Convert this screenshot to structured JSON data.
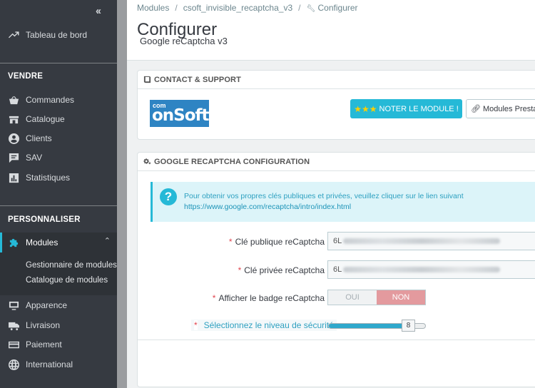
{
  "sidebar": {
    "collapse_icon": "double-chevron-left-icon",
    "dashboard": {
      "label": "Tableau de bord",
      "icon": "trending-up-icon"
    },
    "section_sell": "VENDRE",
    "sell_items": [
      {
        "label": "Commandes",
        "icon": "basket-icon"
      },
      {
        "label": "Catalogue",
        "icon": "store-icon"
      },
      {
        "label": "Clients",
        "icon": "user-circle-icon"
      },
      {
        "label": "SAV",
        "icon": "chat-icon"
      },
      {
        "label": "Statistiques",
        "icon": "bar-chart-icon"
      }
    ],
    "section_custom": "PERSONNALISER",
    "modules": {
      "label": "Modules",
      "icon": "puzzle-icon"
    },
    "modules_sub": [
      "Gestionnaire de modules",
      "Catalogue de modules"
    ],
    "custom_items": [
      {
        "label": "Apparence",
        "icon": "monitor-icon"
      },
      {
        "label": "Livraison",
        "icon": "truck-icon"
      },
      {
        "label": "Paiement",
        "icon": "credit-card-icon"
      },
      {
        "label": "International",
        "icon": "globe-icon"
      }
    ]
  },
  "breadcrumb": {
    "items": [
      "Modules",
      "csoft_invisible_recaptcha_v3",
      "Configurer"
    ],
    "last_icon": "wrench-icon"
  },
  "header": {
    "title": "Configurer",
    "subtitle": "Google reCaptcha v3"
  },
  "contact_panel": {
    "heading": "CONTACT & SUPPORT",
    "heading_icon": "book-icon",
    "logo": {
      "top": "com",
      "main": "onSoft"
    },
    "rate_button": {
      "stars": "★★★",
      "label": "NOTER LE MODULE !"
    },
    "modules_button": {
      "label": "Modules Prestas",
      "icon": "link-icon"
    }
  },
  "config_panel": {
    "heading": "GOOGLE RECAPTCHA CONFIGURATION",
    "heading_icon": "cogs-icon",
    "info": {
      "icon": "question-circle-icon",
      "text": "Pour obtenir vos propres clés publiques et privées, veuillez cliquer sur le lien suivant",
      "link": "https://www.google.com/recaptcha/intro/index.html"
    },
    "required_mark": "*",
    "public_key": {
      "label": "Clé publique reCaptcha",
      "value_prefix": "6L"
    },
    "private_key": {
      "label": "Clé privée reCaptcha",
      "value_prefix": "6L"
    },
    "badge": {
      "label": "Afficher le badge reCaptcha",
      "yes": "OUI",
      "no": "NON",
      "selected": "NON"
    },
    "security": {
      "label": "Sélectionnez le niveau de sécurité",
      "value": "8",
      "max": 10
    }
  },
  "colors": {
    "accent": "#25b9d7",
    "sidebar_bg": "#363a41",
    "toggle_no": "#e39a9e",
    "required": "#e0454f"
  }
}
